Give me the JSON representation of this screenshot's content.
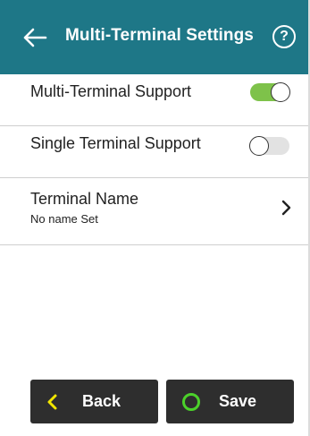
{
  "header": {
    "title": "Multi-Terminal Settings",
    "back_icon": "back-arrow-icon",
    "help_label": "?",
    "background": "#1e7787"
  },
  "settings": [
    {
      "label": "Multi-Terminal Support",
      "toggle": "on"
    },
    {
      "label": "Single Terminal Support",
      "toggle": "off"
    }
  ],
  "terminal_name": {
    "label": "Terminal Name",
    "value": "No name Set",
    "icon": "chevron-right-icon"
  },
  "footer": {
    "back_label": "Back",
    "save_label": "Save",
    "back_icon": "chevron-left-icon",
    "save_icon": "circle-icon"
  },
  "colors": {
    "accent": "#1e7787",
    "toggle_on": "#7ec24a",
    "back_chevron": "#f2e600",
    "save_circle": "#4bd12a",
    "button_bg": "#2e2e2e"
  }
}
